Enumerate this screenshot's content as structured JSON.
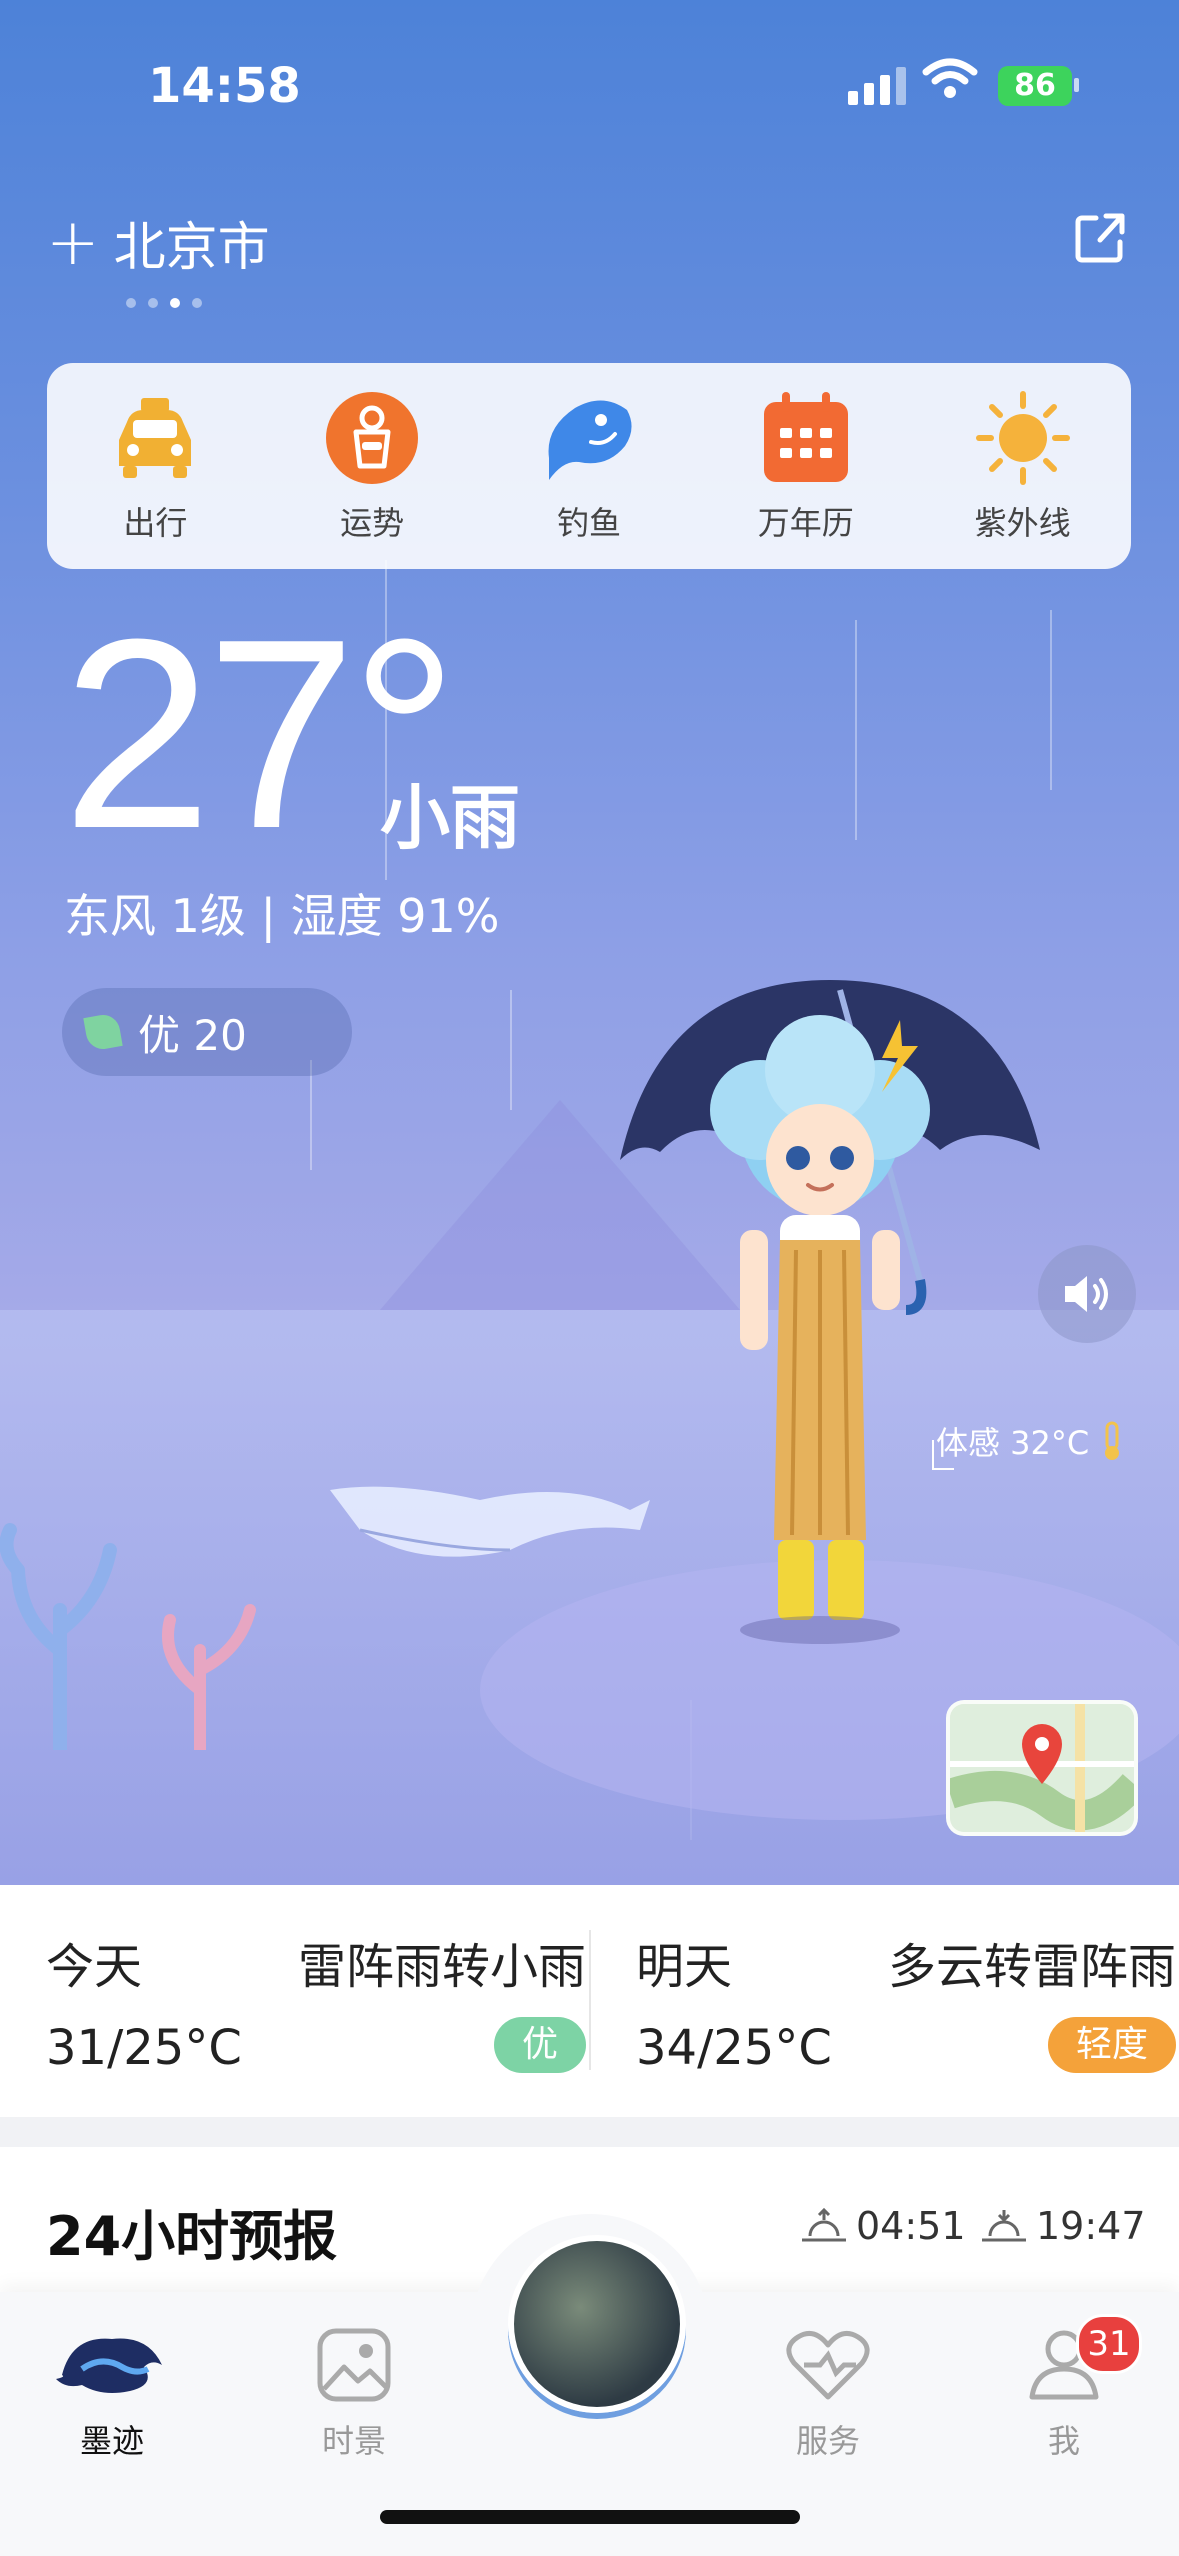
{
  "status_bar": {
    "time": "14:58",
    "battery": "86"
  },
  "header": {
    "city": "北京市",
    "add_icon": "plus-icon",
    "share_icon": "share-icon"
  },
  "tools": [
    {
      "label": "出行",
      "icon": "taxi-icon",
      "color": "#f1b033"
    },
    {
      "label": "运势",
      "icon": "fortune-icon",
      "color": "#f0742d"
    },
    {
      "label": "钓鱼",
      "icon": "fish-icon",
      "color": "#3f88e8"
    },
    {
      "label": "万年历",
      "icon": "calendar-icon",
      "color": "#f26a33"
    },
    {
      "label": "紫外线",
      "icon": "sun-icon",
      "color": "#f5b23b"
    }
  ],
  "current": {
    "temperature": "27°",
    "condition": "小雨",
    "wind_humidity": "东风 1级 | 湿度 91%",
    "aqi": "优 20",
    "feels_like": "体感 32°C"
  },
  "days": [
    {
      "name": "今天",
      "desc": "雷阵雨转小雨",
      "range": "31/25°C",
      "badge": "优",
      "badge_color": "#7dd3a5"
    },
    {
      "name": "明天",
      "desc": "多云转雷阵雨",
      "range": "34/25°C",
      "badge": "轻度",
      "badge_color": "#f4a23a"
    }
  ],
  "forecast": {
    "title": "24小时预报",
    "sunrise": "04:51",
    "sunset": "19:47"
  },
  "tabs": [
    {
      "label": "墨迹",
      "icon": "moji-icon",
      "active": true
    },
    {
      "label": "时景",
      "icon": "image-icon",
      "active": false
    },
    {
      "label": "服务",
      "icon": "heart-icon",
      "active": false
    },
    {
      "label": "我",
      "icon": "user-icon",
      "active": false,
      "badge": "31"
    }
  ]
}
